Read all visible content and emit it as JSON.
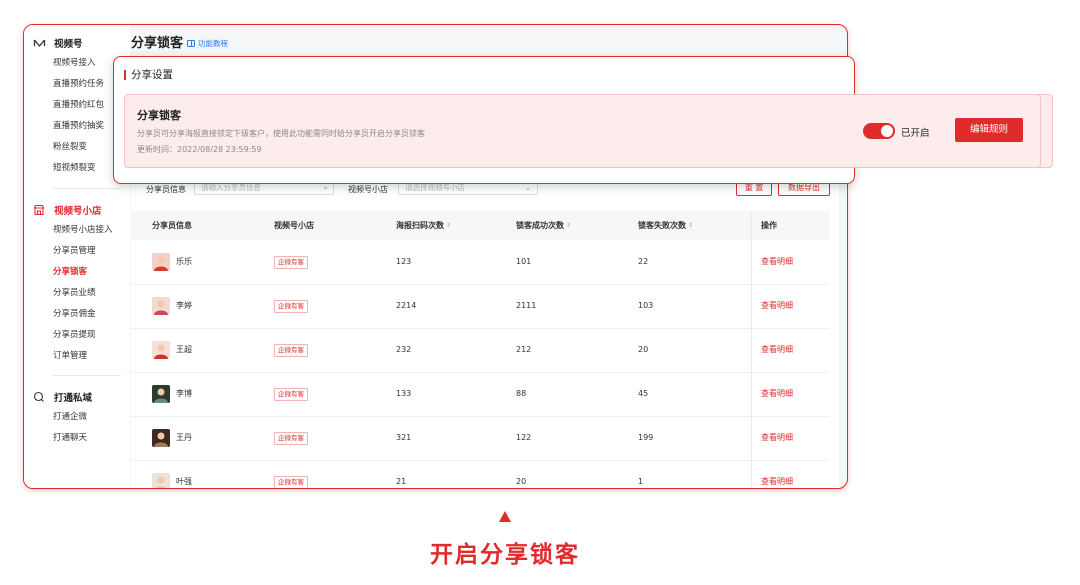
{
  "window": {
    "page_title": "分享锁客",
    "help_link": "功能教程"
  },
  "sidebar": {
    "groups": [
      {
        "title": "视频号",
        "icon": "infinity-icon",
        "items": [
          "视频号接入",
          "直播预约任务",
          "直播预约红包",
          "直播预约抽奖",
          "粉丝裂变",
          "短视频裂变"
        ]
      },
      {
        "title": "视频号小店",
        "icon": "store-icon",
        "items": [
          "视频号小店接入",
          "分享员管理",
          "分享锁客",
          "分享员业绩",
          "分享员佣金",
          "分享员提现",
          "订单管理"
        ]
      },
      {
        "title": "打通私域",
        "icon": "chat-icon",
        "items": [
          "打通企微",
          "打通聊天"
        ]
      }
    ]
  },
  "filters": {
    "sharer_label": "分享员信息",
    "sharer_placeholder": "请输入分享员信息",
    "shop_label": "视频号小店",
    "shop_placeholder": "请选择视频号小店",
    "reset_label": "重 置",
    "export_label": "数据导出"
  },
  "table": {
    "columns": [
      "分享员信息",
      "视频号小店",
      "海报扫码次数",
      "锁客成功次数",
      "锁客失败次数",
      "操作"
    ],
    "rows": [
      {
        "name": "乐乐",
        "shop": "企微有客",
        "scans": "123",
        "success": "101",
        "fail": "22",
        "action": "查看明细"
      },
      {
        "name": "李婷",
        "shop": "企微有客",
        "scans": "2214",
        "success": "2111",
        "fail": "103",
        "action": "查看明细"
      },
      {
        "name": "王超",
        "shop": "企微有客",
        "scans": "232",
        "success": "212",
        "fail": "20",
        "action": "查看明细"
      },
      {
        "name": "李博",
        "shop": "企微有客",
        "scans": "133",
        "success": "88",
        "fail": "45",
        "action": "查看明细"
      },
      {
        "name": "王丹",
        "shop": "企微有客",
        "scans": "321",
        "success": "122",
        "fail": "199",
        "action": "查看明细"
      },
      {
        "name": "叶强",
        "shop": "企微有客",
        "scans": "21",
        "success": "20",
        "fail": "1",
        "action": "查看明细"
      }
    ]
  },
  "overlay": {
    "title": "分享设置",
    "card_title": "分享锁客",
    "card_desc": "分享员可分享海报直接锁定下级客户，使用此功能需同时给分享员开启分享员锁客",
    "card_time": "更新时间：2022/08/28 23:59:59",
    "toggle_label": "已开启",
    "toggle_on": true,
    "edit_button": "编辑规则"
  },
  "caption": "开启分享锁客",
  "colors": {
    "accent": "#e02b2b",
    "card_bg": "#fdecec"
  }
}
